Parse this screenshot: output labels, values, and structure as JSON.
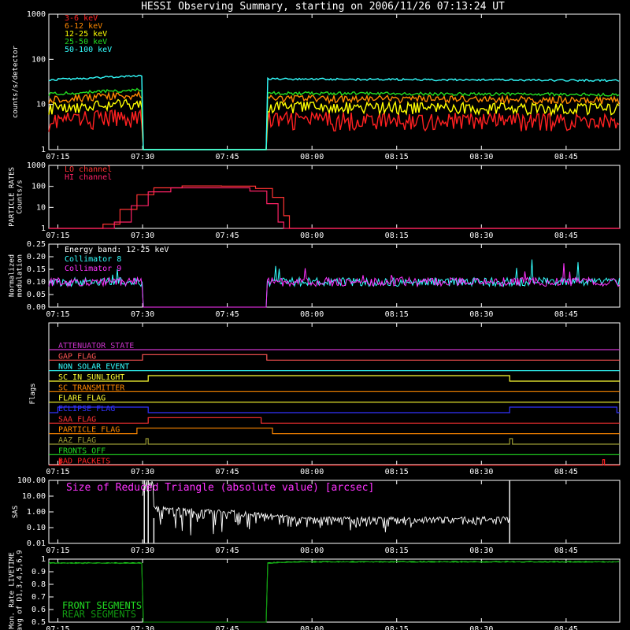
{
  "title": "HESSI Observing Summary, starting on 2006/11/26 07:13:24 UT",
  "time_ticks": [
    "07:15",
    "07:30",
    "07:45",
    "08:00",
    "08:15",
    "08:30",
    "08:45"
  ],
  "chart_data": [
    {
      "type": "line",
      "ylabel": "counts/s/detector",
      "yscale": "log",
      "ylim": [
        1,
        1000
      ],
      "y_ticks": [
        "1",
        "10",
        "100",
        "1000"
      ],
      "gap": [
        "07:30",
        "07:52"
      ],
      "series": [
        {
          "name": "3-6 keV",
          "color": "#ff2020",
          "level": 4.5
        },
        {
          "name": "6-12 keV",
          "color": "#ff8800",
          "level": 13
        },
        {
          "name": "12-25 keV",
          "color": "#ffff00",
          "level": 8.5
        },
        {
          "name": "25-50 keV",
          "color": "#22dd22",
          "level": 17
        },
        {
          "name": "50-100 keV",
          "color": "#33ffff",
          "level": 35
        }
      ]
    },
    {
      "type": "line",
      "ylabel": "PARTICLE RATES Counts/s",
      "yscale": "log",
      "ylim": [
        1,
        1000
      ],
      "y_ticks": [
        "1",
        "10",
        "100",
        "1000"
      ],
      "series": [
        {
          "name": "LO channel",
          "color": "#ff3333"
        },
        {
          "name": "HI channel",
          "color": "#ff2266"
        }
      ]
    },
    {
      "type": "line",
      "ylabel": "Normalized modulation",
      "ylim": [
        0,
        0.25
      ],
      "y_ticks": [
        "0.00",
        "0.05",
        "0.10",
        "0.15",
        "0.20",
        "0.25"
      ],
      "annotation": "Energy band: 12-25 keV",
      "gap": [
        "07:30",
        "07:52"
      ],
      "series": [
        {
          "name": "Collimator 8",
          "color": "#33ffff",
          "level": 0.1
        },
        {
          "name": "Collimator 9",
          "color": "#ff33ff",
          "level": 0.1
        }
      ]
    },
    {
      "type": "step",
      "ylabel": "Flags",
      "flags": [
        {
          "name": "ATTENUATOR STATE",
          "color": "#cc33cc",
          "on": []
        },
        {
          "name": "GAP FLAG",
          "color": "#ff5555",
          "on": [
            [
              "07:30",
              "07:52"
            ]
          ]
        },
        {
          "name": "NON SOLAR EVENT",
          "color": "#33ffff",
          "on": []
        },
        {
          "name": "SC IN SUNLIGHT",
          "color": "#ffff33",
          "on": [
            [
              "07:31",
              "08:35"
            ]
          ]
        },
        {
          "name": "SC TRANSMITTER",
          "color": "#ff8800",
          "on": []
        },
        {
          "name": "FLARE FLAG",
          "color": "#ffff33",
          "on": []
        },
        {
          "name": "ECLIPSE FLAG",
          "color": "#3333ff",
          "on": [
            [
              "07:15",
              "07:31"
            ],
            [
              "08:35",
              "08:54"
            ]
          ]
        },
        {
          "name": "SAA FLAG",
          "color": "#ff3333",
          "on": [
            [
              "07:31",
              "07:51"
            ]
          ]
        },
        {
          "name": "PARTICLE FLAG",
          "color": "#ff8800",
          "on": [
            [
              "07:29",
              "07:53"
            ]
          ]
        },
        {
          "name": "AAZ FLAG",
          "color": "#999933",
          "on": [
            [
              "07:30.6",
              "07:31"
            ],
            [
              "08:35",
              "08:35.5"
            ]
          ]
        },
        {
          "name": "FRONTS OFF",
          "color": "#22dd22",
          "on": []
        },
        {
          "name": "BAD PACKETS",
          "color": "#ff2222",
          "on": [
            [
              "07:15.3",
              "07:15.5"
            ],
            [
              "08:51.5",
              "08:51.8"
            ]
          ]
        }
      ]
    },
    {
      "type": "line",
      "ylabel": "SAS",
      "yscale": "log",
      "ylim": [
        0.01,
        100
      ],
      "y_ticks": [
        "0.01",
        "0.10",
        "1.00",
        "10.00",
        "100.00"
      ],
      "annotation": "Size of Reduced Triangle (absolute value) [arcsec]",
      "series": [
        {
          "name": "",
          "color": "#ffffff"
        }
      ]
    },
    {
      "type": "line",
      "ylabel": "Mon. Rate LIVETIME avg of D1,3,4,5,6,9",
      "ylim": [
        0.5,
        1.0
      ],
      "y_ticks": [
        "0.5",
        "0.6",
        "0.7",
        "0.8",
        "0.9",
        "1"
      ],
      "gap": [
        "07:30",
        "07:52"
      ],
      "series": [
        {
          "name": "FRONT SEGMENTS",
          "color": "#22dd22",
          "level": 0.97
        },
        {
          "name": "REAR SEGMENTS",
          "color": "#119911",
          "level": 0.97
        }
      ]
    }
  ]
}
